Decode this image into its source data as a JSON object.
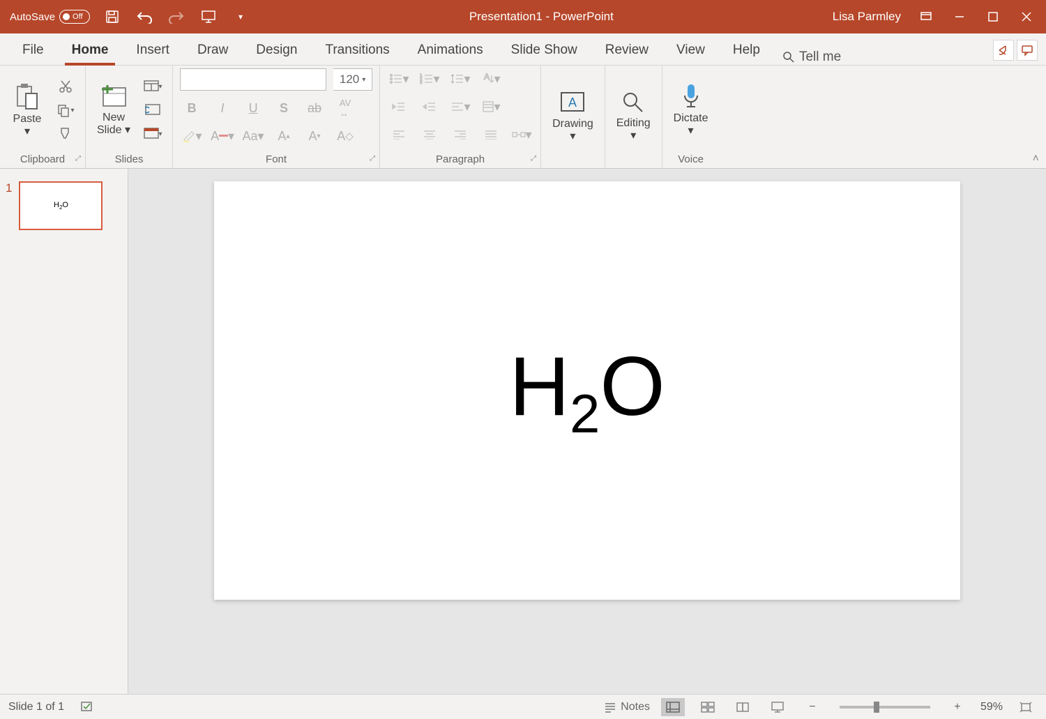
{
  "title": {
    "autosave_label": "AutoSave",
    "autosave_state": "Off",
    "doc_title": "Presentation1  -  PowerPoint",
    "user": "Lisa Parmley"
  },
  "tabs": {
    "items": [
      "File",
      "Home",
      "Insert",
      "Draw",
      "Design",
      "Transitions",
      "Animations",
      "Slide Show",
      "Review",
      "View",
      "Help"
    ],
    "active": "Home",
    "tellme": "Tell me"
  },
  "ribbon": {
    "clipboard": {
      "paste": "Paste",
      "label": "Clipboard"
    },
    "slides": {
      "newslide_l1": "New",
      "newslide_l2": "Slide",
      "label": "Slides"
    },
    "font": {
      "size": "120",
      "label": "Font"
    },
    "paragraph": {
      "label": "Paragraph"
    },
    "drawing": {
      "btn": "Drawing",
      "label": ""
    },
    "editing": {
      "btn": "Editing",
      "label": ""
    },
    "voice": {
      "btn": "Dictate",
      "label": "Voice"
    }
  },
  "thumbs": {
    "num": "1",
    "formula_h": "H",
    "formula_2": "2",
    "formula_o": "O"
  },
  "slide": {
    "formula_h": "H",
    "formula_2": "2",
    "formula_o": "O"
  },
  "status": {
    "slide_info": "Slide 1 of 1",
    "notes": "Notes",
    "zoom": "59%"
  }
}
